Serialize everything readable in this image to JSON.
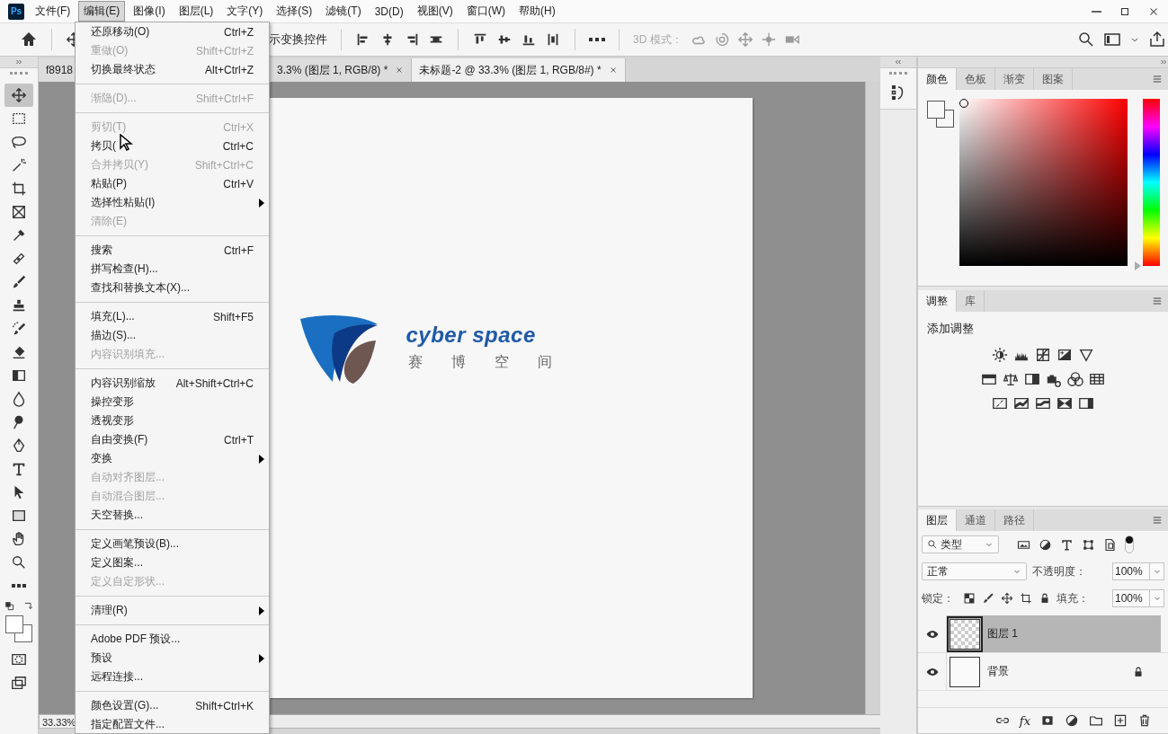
{
  "app": {
    "logo": "Ps"
  },
  "menubar": [
    {
      "label": "文件(F)",
      "selected": false
    },
    {
      "label": "编辑(E)",
      "selected": true
    },
    {
      "label": "图像(I)",
      "selected": false
    },
    {
      "label": "图层(L)",
      "selected": false
    },
    {
      "label": "文字(Y)",
      "selected": false
    },
    {
      "label": "选择(S)",
      "selected": false
    },
    {
      "label": "滤镜(T)",
      "selected": false
    },
    {
      "label": "3D(D)",
      "selected": false
    },
    {
      "label": "视图(V)",
      "selected": false
    },
    {
      "label": "窗口(W)",
      "selected": false
    },
    {
      "label": "帮助(H)",
      "selected": false
    }
  ],
  "options_bar": {
    "transform_label": "示变换控件",
    "mode_label": "3D 模式："
  },
  "document_tabs": [
    {
      "label": "f8918",
      "selected": false
    },
    {
      "label": "3.3% (图层 1, RGB/8) *",
      "selected": false
    },
    {
      "label": "未标题-2 @ 33.3% (图层 1, RGB/8#) *",
      "selected": true
    }
  ],
  "tools": [
    {
      "selected": true
    },
    {
      "selected": false
    },
    {
      "selected": false
    },
    {
      "selected": false
    },
    {
      "selected": false
    },
    {
      "selected": false
    },
    {
      "selected": false
    },
    {
      "selected": false
    },
    {
      "selected": false
    },
    {
      "selected": false
    },
    {
      "selected": false
    },
    {
      "selected": false
    },
    {
      "selected": false
    },
    {
      "selected": false
    },
    {
      "selected": false
    },
    {
      "selected": false
    },
    {
      "selected": false
    },
    {
      "selected": false
    },
    {
      "selected": false
    },
    {
      "selected": false
    },
    {
      "selected": false
    },
    {
      "selected": false
    }
  ],
  "canvas": {
    "brand": "cyber space",
    "subtitle": [
      "赛",
      "博",
      "空",
      "间"
    ]
  },
  "zoom_level": "33.33%",
  "edit_menu": {
    "groups": [
      [
        {
          "label": "还原移动(O)",
          "shortcut": "Ctrl+Z",
          "disabled": false,
          "submenu": false
        },
        {
          "label": "重做(O)",
          "shortcut": "Shift+Ctrl+Z",
          "disabled": true,
          "submenu": false
        },
        {
          "label": "切换最终状态",
          "shortcut": "Alt+Ctrl+Z",
          "disabled": false,
          "submenu": false
        }
      ],
      [
        {
          "label": "渐隐(D)...",
          "shortcut": "Shift+Ctrl+F",
          "disabled": true,
          "submenu": false
        }
      ],
      [
        {
          "label": "剪切(T)",
          "shortcut": "Ctrl+X",
          "disabled": true,
          "submenu": false
        },
        {
          "label": "拷贝(",
          "shortcut": "Ctrl+C",
          "disabled": false,
          "submenu": false
        },
        {
          "label": "合并拷贝(Y)",
          "shortcut": "Shift+Ctrl+C",
          "disabled": true,
          "submenu": false
        },
        {
          "label": "粘贴(P)",
          "shortcut": "Ctrl+V",
          "disabled": false,
          "submenu": false
        },
        {
          "label": "选择性粘贴(I)",
          "disabled": false,
          "submenu": true
        },
        {
          "label": "清除(E)",
          "disabled": true,
          "submenu": false
        }
      ],
      [
        {
          "label": "搜索",
          "shortcut": "Ctrl+F",
          "disabled": false,
          "submenu": false
        },
        {
          "label": "拼写检查(H)...",
          "disabled": false,
          "submenu": false
        },
        {
          "label": "查找和替换文本(X)...",
          "disabled": false,
          "submenu": false
        }
      ],
      [
        {
          "label": "填充(L)...",
          "shortcut": "Shift+F5",
          "disabled": false,
          "submenu": false
        },
        {
          "label": "描边(S)...",
          "disabled": false,
          "submenu": false
        },
        {
          "label": "内容识别填充...",
          "disabled": true,
          "submenu": false
        }
      ],
      [
        {
          "label": "内容识别缩放",
          "shortcut": "Alt+Shift+Ctrl+C",
          "disabled": false,
          "submenu": false
        },
        {
          "label": "操控变形",
          "disabled": false,
          "submenu": false
        },
        {
          "label": "透视变形",
          "disabled": false,
          "submenu": false
        },
        {
          "label": "自由变换(F)",
          "shortcut": "Ctrl+T",
          "disabled": false,
          "submenu": false
        },
        {
          "label": "变换",
          "disabled": false,
          "submenu": true
        },
        {
          "label": "自动对齐图层...",
          "disabled": true,
          "submenu": false
        },
        {
          "label": "自动混合图层...",
          "disabled": true,
          "submenu": false
        },
        {
          "label": "天空替换...",
          "disabled": false,
          "submenu": false
        }
      ],
      [
        {
          "label": "定义画笔预设(B)...",
          "disabled": false,
          "submenu": false
        },
        {
          "label": "定义图案...",
          "disabled": false,
          "submenu": false
        },
        {
          "label": "定义自定形状...",
          "disabled": true,
          "submenu": false
        }
      ],
      [
        {
          "label": "清理(R)",
          "disabled": false,
          "submenu": true
        }
      ],
      [
        {
          "label": "Adobe PDF 预设...",
          "disabled": false,
          "submenu": false
        },
        {
          "label": "预设",
          "disabled": false,
          "submenu": true
        },
        {
          "label": "远程连接...",
          "disabled": false,
          "submenu": false
        }
      ],
      [
        {
          "label": "颜色设置(G)...",
          "shortcut": "Shift+Ctrl+K",
          "disabled": false,
          "submenu": false
        },
        {
          "label": "指定配置文件...",
          "disabled": false,
          "submenu": false
        }
      ]
    ]
  },
  "color_panel": {
    "tabs": [
      {
        "label": "颜色",
        "selected": true
      },
      {
        "label": "色板",
        "selected": false
      },
      {
        "label": "渐变",
        "selected": false
      },
      {
        "label": "图案",
        "selected": false
      }
    ],
    "hue": {
      "level": 0
    }
  },
  "adjustments_panel": {
    "tabs": [
      {
        "label": "调整",
        "selected": true
      },
      {
        "label": "库",
        "selected": false
      }
    ],
    "heading": "添加调整"
  },
  "layers_panel": {
    "tabs": [
      {
        "label": "图层",
        "selected": true
      },
      {
        "label": "通道",
        "selected": false
      },
      {
        "label": "路径",
        "selected": false
      }
    ],
    "filter": "类型",
    "blend_mode": "正常",
    "opacity_label": "不透明度：",
    "opacity": "100%",
    "lock_label": "锁定：",
    "fill_label": "填充：",
    "fill": "100%",
    "layers": [
      {
        "name": "图层 1",
        "selected": true,
        "visible": true,
        "locked": false,
        "transparent": true
      },
      {
        "name": "背景",
        "selected": false,
        "visible": true,
        "locked": true,
        "transparent": false
      }
    ],
    "effects_label": "fx"
  }
}
